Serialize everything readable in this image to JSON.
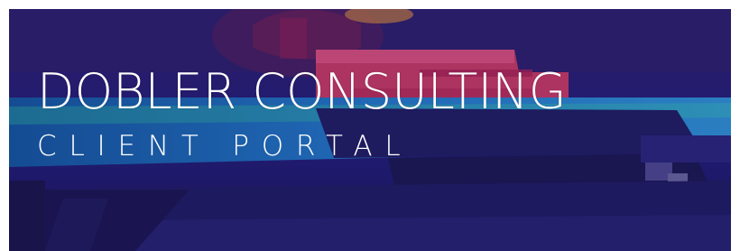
{
  "banner": {
    "title": "DOBLER CONSULTING",
    "subtitle": "CLIENT PORTAL",
    "text_color": "#ffffff",
    "overlay_color": "#2a1a72",
    "background_icon": "3d-printer-photo"
  }
}
